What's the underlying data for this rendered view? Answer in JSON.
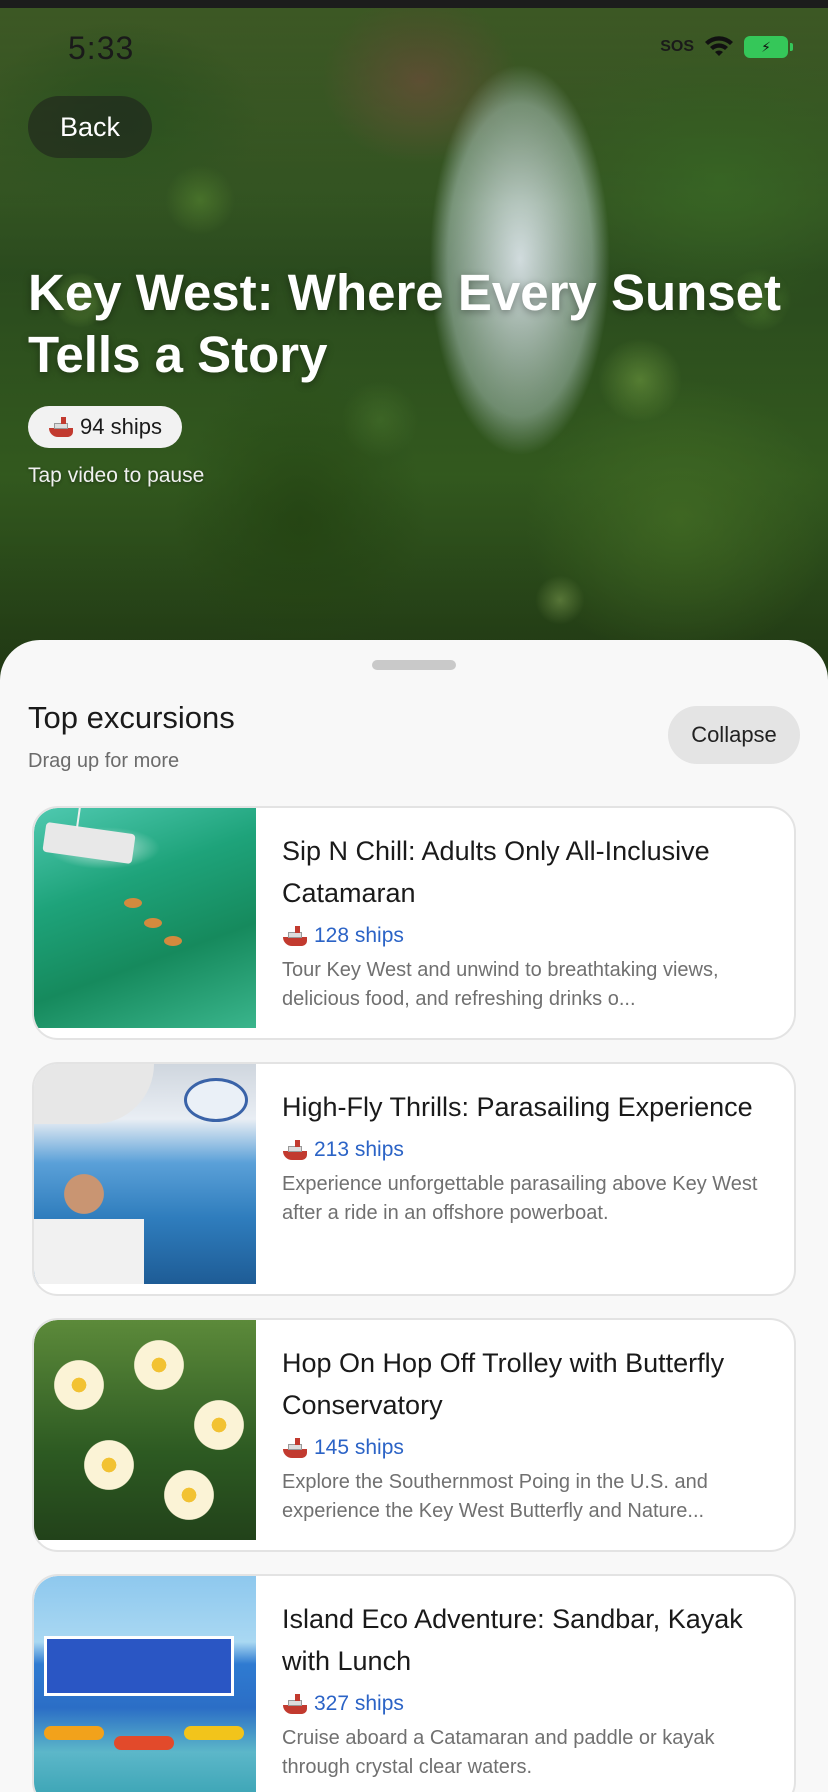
{
  "status_bar": {
    "time": "5:33",
    "sos": "SOS"
  },
  "hero": {
    "back_label": "Back",
    "title": "Key West: Where Every Sunset Tells a Story",
    "ships_count": "94 ships",
    "tap_hint": "Tap video to pause"
  },
  "sheet": {
    "title": "Top excursions",
    "subtitle": "Drag up for more",
    "collapse_label": "Collapse"
  },
  "excursions": [
    {
      "title": "Sip N Chill: Adults Only All-Inclusive Catamaran",
      "ships": "128 ships",
      "description": "Tour Key West and unwind to breathtaking views, delicious food, and refreshing drinks o..."
    },
    {
      "title": "High-Fly Thrills: Parasailing Experience",
      "ships": "213 ships",
      "description": "Experience unforgettable parasailing above Key West after a ride in an offshore powerboat."
    },
    {
      "title": "Hop On Hop Off Trolley with Butterfly Conservatory",
      "ships": "145 ships",
      "description": "Explore the Southernmost Poing in the U.S. and experience the Key West Butterfly and Nature..."
    },
    {
      "title": "Island Eco Adventure: Sandbar, Kayak with Lunch",
      "ships": "327 ships",
      "description": "Cruise aboard a Catamaran and paddle or kayak through crystal clear waters."
    }
  ],
  "colors": {
    "accent_blue": "#2b63c6",
    "ship_red": "#c23a2f",
    "battery_green": "#35c759"
  }
}
